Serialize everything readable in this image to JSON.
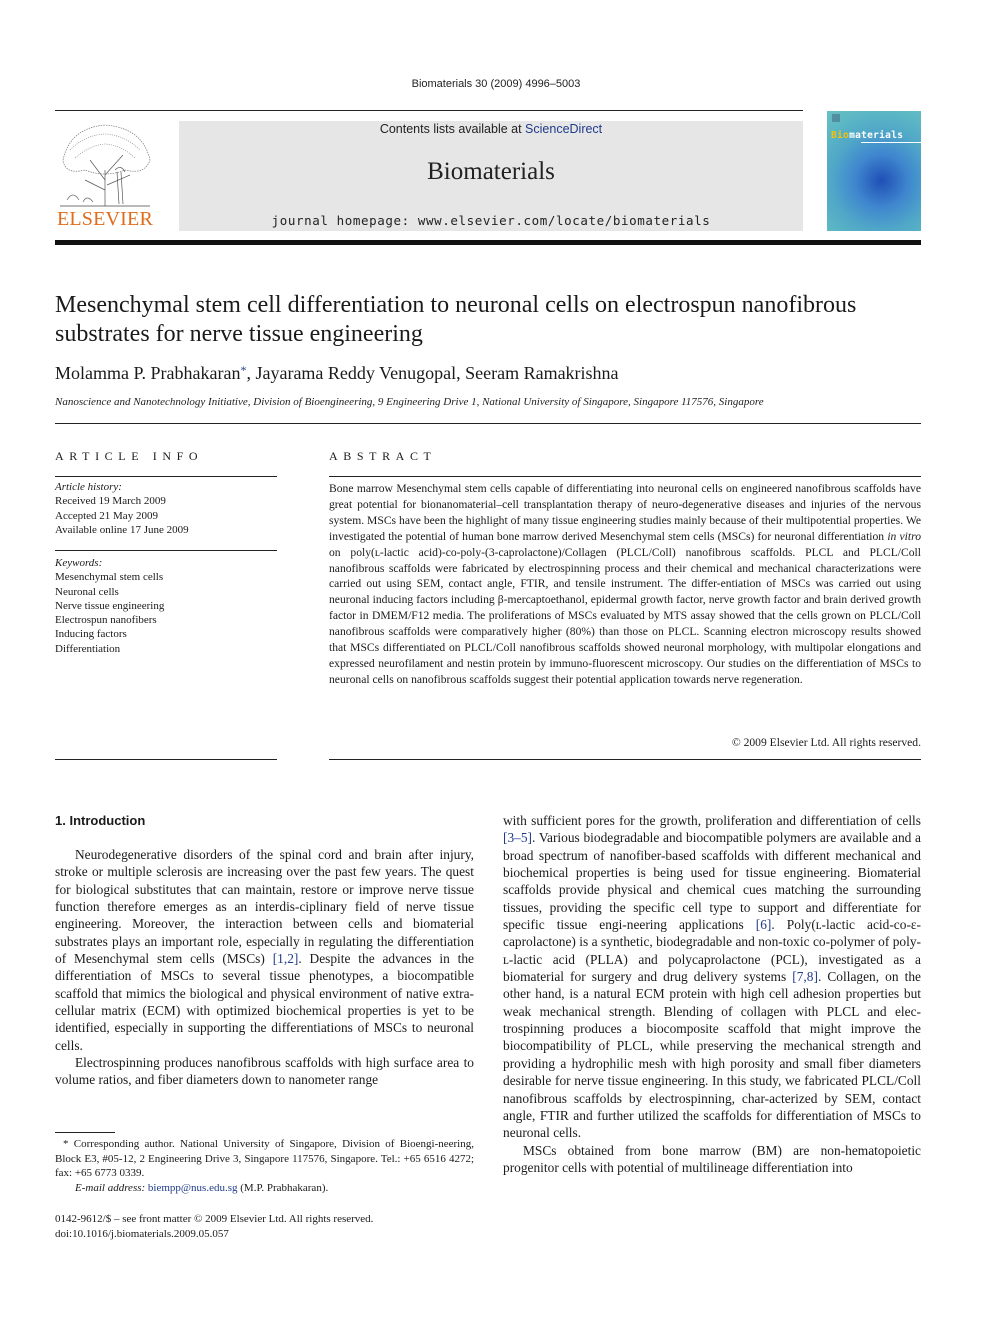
{
  "header": {
    "citation": "Biomaterials 30 (2009) 4996–5003",
    "contents_prefix": "Contents lists available at ",
    "contents_link": "ScienceDirect",
    "journal_name": "Biomaterials",
    "homepage": "journal homepage: www.elsevier.com/locate/biomaterials",
    "publisher_logo_text": "ELSEVIER",
    "cover_title_bio": "Bio",
    "cover_title_rest": "materials"
  },
  "article": {
    "title": "Mesenchymal stem cell differentiation to neuronal cells on electrospun nanofibrous substrates for nerve tissue engineering",
    "authors": [
      {
        "name": "Molamma P. Prabhakaran",
        "mark": "*"
      },
      {
        "name": "Jayarama Reddy Venugopal",
        "mark": ""
      },
      {
        "name": "Seeram Ramakrishna",
        "mark": ""
      }
    ],
    "author_sep": ", ",
    "affiliation": "Nanoscience and Nanotechnology Initiative, Division of Bioengineering, 9 Engineering Drive 1, National University of Singapore, Singapore 117576, Singapore"
  },
  "article_info": {
    "heading": "ARTICLE INFO",
    "history_label": "Article history:",
    "history": [
      "Received 19 March 2009",
      "Accepted 21 May 2009",
      "Available online 17 June 2009"
    ],
    "keywords_label": "Keywords:",
    "keywords": [
      "Mesenchymal stem cells",
      "Neuronal cells",
      "Nerve tissue engineering",
      "Electrospun nanofibers",
      "Inducing factors",
      "Differentiation"
    ]
  },
  "abstract": {
    "heading": "ABSTRACT",
    "text_part1": "Bone marrow Mesenchymal stem cells capable of differentiating into neuronal cells on engineered nanofibrous scaffolds have great potential for bionanomaterial–cell transplantation therapy of neuro-degenerative diseases and injuries of the nervous system. MSCs have been the highlight of many tissue engineering studies mainly because of their multipotential properties. We investigated the potential of human bone marrow derived Mesenchymal stem cells (MSCs) for neuronal differentiation ",
    "text_italic": "in vitro",
    "text_part2": " on poly(ʟ-lactic acid)-co-poly-(3-caprolactone)/Collagen (PLCL/Coll) nanofibrous scaffolds. PLCL and PLCL/Coll nanofibrous scaffolds were fabricated by electrospinning process and their chemical and mechanical characterizations were carried out using SEM, contact angle, FTIR, and tensile instrument. The differ-entiation of MSCs was carried out using neuronal inducing factors including β-mercaptoethanol, epidermal growth factor, nerve growth factor and brain derived growth factor in DMEM/F12 media. The proliferations of MSCs evaluated by MTS assay showed that the cells grown on PLCL/Coll nanofibrous scaffolds were comparatively higher (80%) than those on PLCL. Scanning electron microscopy results showed that MSCs differentiated on PLCL/Coll nanofibrous scaffolds showed neuronal morphology, with multipolar elongations and expressed neurofilament and nestin protein by immuno-fluorescent microscopy. Our studies on the differentiation of MSCs to neuronal cells on nanofibrous scaffolds suggest their potential application towards nerve regeneration.",
    "copyright": "© 2009 Elsevier Ltd. All rights reserved."
  },
  "introduction": {
    "heading": "1.  Introduction",
    "left_p1_a": "Neurodegenerative disorders of the spinal cord and brain after injury, stroke or multiple sclerosis are increasing over the past few years. The quest for biological substitutes that can maintain, restore or improve nerve tissue function therefore emerges as an interdis-ciplinary field of nerve tissue engineering. Moreover, the interaction between cells and biomaterial substrates plays an important role, especially in regulating the differentiation of Mesenchymal stem cells (MSCs) ",
    "left_p1_ref": "[1,2]",
    "left_p1_b": ". Despite the advances in the differentiation of MSCs to several tissue phenotypes, a biocompatible scaffold that mimics the biological and physical environment of native extra-cellular matrix (ECM) with optimized biochemical properties is yet to be identified, especially in supporting the differentiations of MSCs to neuronal cells.",
    "left_p2": "Electrospinning produces nanofibrous scaffolds with high surface area to volume ratios, and fiber diameters down to nanometer range",
    "right_p1_a": "with sufficient pores for the growth, proliferation and differentiation of cells ",
    "right_p1_ref1": "[3–5]",
    "right_p1_b": ". Various biodegradable and biocompatible polymers are available and a broad spectrum of nanofiber-based scaffolds with different mechanical and biochemical properties is being used for tissue engineering. Biomaterial scaffolds provide physical and chemical cues matching the surrounding tissues, providing the specific cell type to support and differentiate for specific tissue engi-neering applications ",
    "right_p1_ref2": "[6]",
    "right_p1_c": ". Poly(ʟ-lactic acid-co-ε-caprolactone) is a synthetic, biodegradable and non-toxic co-polymer of poly-ʟ-lactic acid (PLLA) and polycaprolactone (PCL), investigated as a biomaterial for surgery and drug delivery systems ",
    "right_p1_ref3": "[7,8]",
    "right_p1_d": ". Collagen, on the other hand, is a natural ECM protein with high cell adhesion properties but weak mechanical strength. Blending of collagen with PLCL and elec-trospinning produces a biocomposite scaffold that might improve the biocompatibility of PLCL, while preserving the mechanical strength and providing a hydrophilic mesh with high porosity and small fiber diameters desirable for nerve tissue engineering. In this study, we fabricated PLCL/Coll nanofibrous scaffolds by electrospinning, char-acterized by SEM, contact angle, FTIR and further utilized the scaffolds for differentiation of MSCs to neuronal cells.",
    "right_p2": "MSCs obtained from bone marrow (BM) are non-hematopoietic progenitor cells with potential of multilineage differentiation into"
  },
  "footnote": {
    "mark": "*",
    "text": " Corresponding author. National University of Singapore, Division of Bioengi-neering, Block E3, #05-12, 2 Engineering Drive 3, Singapore 117576, Singapore. Tel.: +65 6516 4272; fax: +65 6773 0339.",
    "email_label": "E-mail address: ",
    "email": "biempp@nus.edu.sg",
    "email_suffix": " (M.P. Prabhakaran)."
  },
  "bottom_meta": {
    "issn_line": "0142-9612/$ – see front matter © 2009 Elsevier Ltd. All rights reserved.",
    "doi": "doi:10.1016/j.biomaterials.2009.05.057"
  },
  "colors": {
    "link": "#1f3c8a",
    "elsevier_orange": "#e06b1a",
    "masthead_gray": "#e6e6e6"
  }
}
